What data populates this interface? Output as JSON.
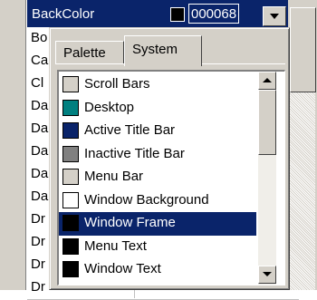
{
  "property_grid": {
    "selected": {
      "name": "BackColor",
      "value": "000068",
      "swatch_color": "#000000"
    },
    "rows": [
      "Bo",
      "Ca",
      "Cl",
      "Da",
      "Da",
      "Da",
      "Da",
      "Da",
      "Dr",
      "Dr",
      "Dr",
      "Dr"
    ]
  },
  "popup": {
    "tabs": {
      "palette": "Palette",
      "system": "System"
    },
    "active_tab": "System",
    "items": [
      {
        "label": "Scroll Bars",
        "color": "#d4d0c8"
      },
      {
        "label": "Desktop",
        "color": "#008080"
      },
      {
        "label": "Active Title Bar",
        "color": "#0a246a"
      },
      {
        "label": "Inactive Title Bar",
        "color": "#808080"
      },
      {
        "label": "Menu Bar",
        "color": "#d4d0c8"
      },
      {
        "label": "Window Background",
        "color": "#ffffff"
      },
      {
        "label": "Window Frame",
        "color": "#000000",
        "selected": true
      },
      {
        "label": "Menu Text",
        "color": "#000000"
      },
      {
        "label": "Window Text",
        "color": "#000000"
      }
    ]
  },
  "colors": {
    "selection": "#0a246a",
    "face": "#d4d0c8"
  }
}
